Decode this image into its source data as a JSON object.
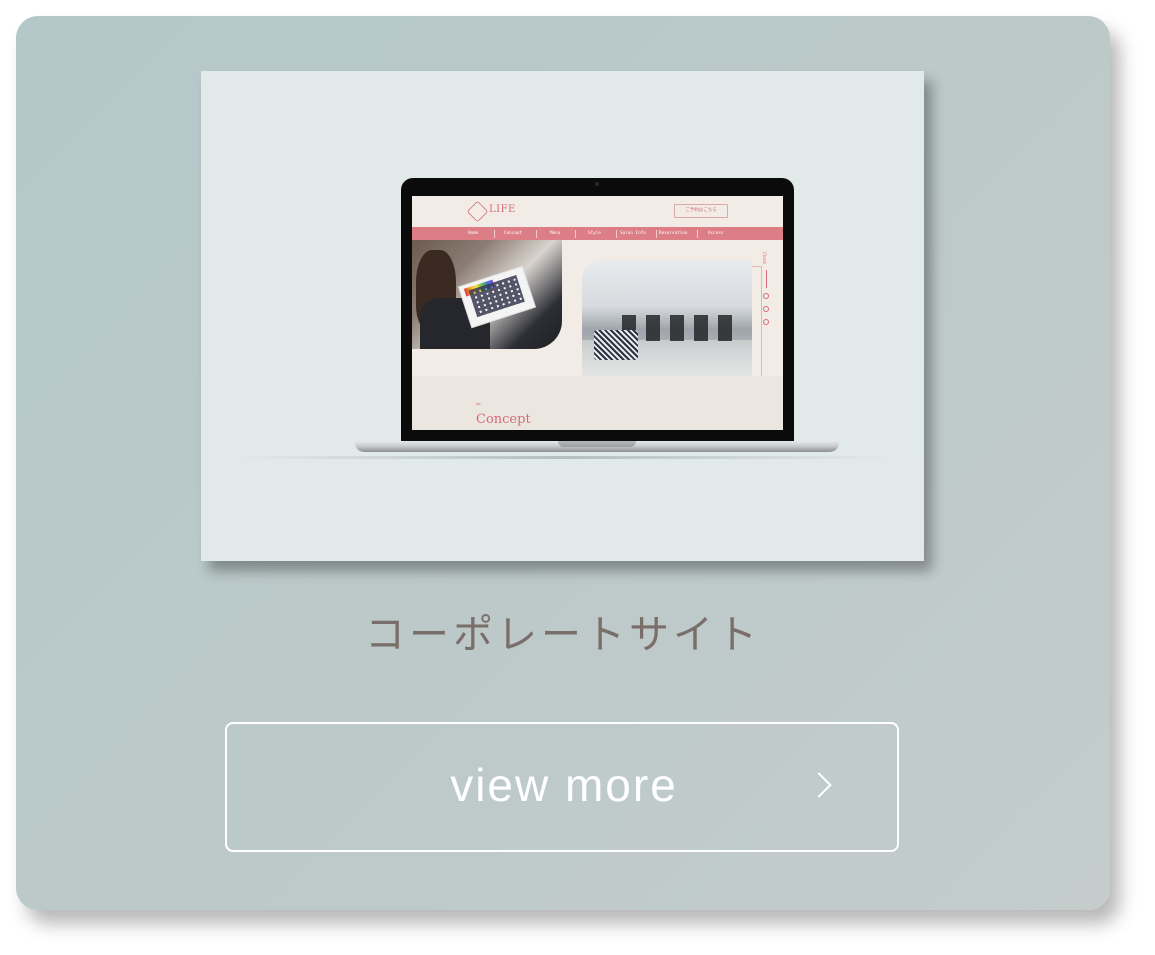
{
  "card": {
    "title": "コーポレートサイト",
    "button_label": "view more",
    "button_icon": "chevron-right-icon"
  },
  "thumbnail": {
    "site": {
      "logo_text": "LIFE",
      "reserve_label": "ご予約はこちら",
      "nav": [
        "Home",
        "Concept",
        "Menu",
        "Style",
        "Salon Info",
        "Reservation",
        "Access"
      ],
      "side_label": "Check",
      "section_heading": "Concept"
    }
  },
  "colors": {
    "card_bg": "#bcc9c9",
    "thumb_bg": "#e2eae9",
    "accent_pink": "#dd7d85",
    "title_text": "#7a6e6b",
    "button_border": "#ffffff"
  }
}
